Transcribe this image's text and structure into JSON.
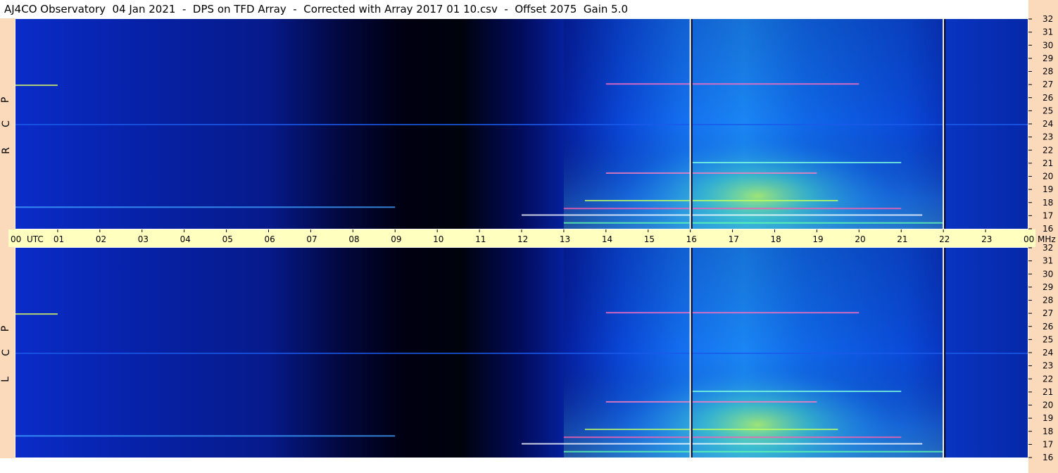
{
  "header": {
    "title": "AJ4CO Observatory  04 Jan 2021  -  DPS on TFD Array  -  Corrected with Array 2017 01 10.csv  -  Offset 2075  Gain 5.0"
  },
  "panels": {
    "top_label": [
      "R",
      "C",
      "P"
    ],
    "bottom_label": [
      "L",
      "C",
      "P"
    ]
  },
  "time_axis": {
    "labels": [
      "00",
      "UTC",
      "01",
      "02",
      "03",
      "04",
      "05",
      "06",
      "07",
      "08",
      "09",
      "10",
      "11",
      "12",
      "13",
      "14",
      "15",
      "16",
      "17",
      "18",
      "19",
      "20",
      "21",
      "22",
      "23",
      "00",
      "MHz"
    ]
  },
  "chart_data": [
    {
      "type": "heatmap",
      "panel": "RCP",
      "x": [
        0,
        1,
        2,
        3,
        4,
        5,
        6,
        7,
        8,
        9,
        10,
        11,
        12,
        13,
        14,
        15,
        16,
        17,
        18,
        19,
        20,
        21,
        22,
        23,
        24
      ],
      "xlabel": "UTC",
      "ylabel": "MHz",
      "y_ticks": [
        16,
        17,
        18,
        19,
        20,
        21,
        22,
        23,
        24,
        25,
        26,
        27,
        28,
        29,
        30,
        31,
        32
      ],
      "xlim": [
        0,
        24
      ],
      "ylim": [
        16,
        32
      ],
      "colormap": [
        "#000010",
        "#0010a0",
        "#0050e0",
        "#10a0ff",
        "#40e0c0",
        "#c0ff40",
        "#ff40a0",
        "#ffffff"
      ],
      "vertical_markers_utc": [
        16,
        22
      ]
    },
    {
      "type": "heatmap",
      "panel": "LCP",
      "x": [
        0,
        1,
        2,
        3,
        4,
        5,
        6,
        7,
        8,
        9,
        10,
        11,
        12,
        13,
        14,
        15,
        16,
        17,
        18,
        19,
        20,
        21,
        22,
        23,
        24
      ],
      "xlabel": "UTC",
      "ylabel": "MHz",
      "y_ticks": [
        16,
        17,
        18,
        19,
        20,
        21,
        22,
        23,
        24,
        25,
        26,
        27,
        28,
        29,
        30,
        31,
        32
      ],
      "xlim": [
        0,
        24
      ],
      "ylim": [
        16,
        32
      ],
      "colormap": [
        "#000010",
        "#0010a0",
        "#0050e0",
        "#10a0ff",
        "#40e0c0",
        "#c0ff40",
        "#ff40a0",
        "#ffffff"
      ],
      "vertical_markers_utc": [
        16,
        22
      ]
    }
  ]
}
